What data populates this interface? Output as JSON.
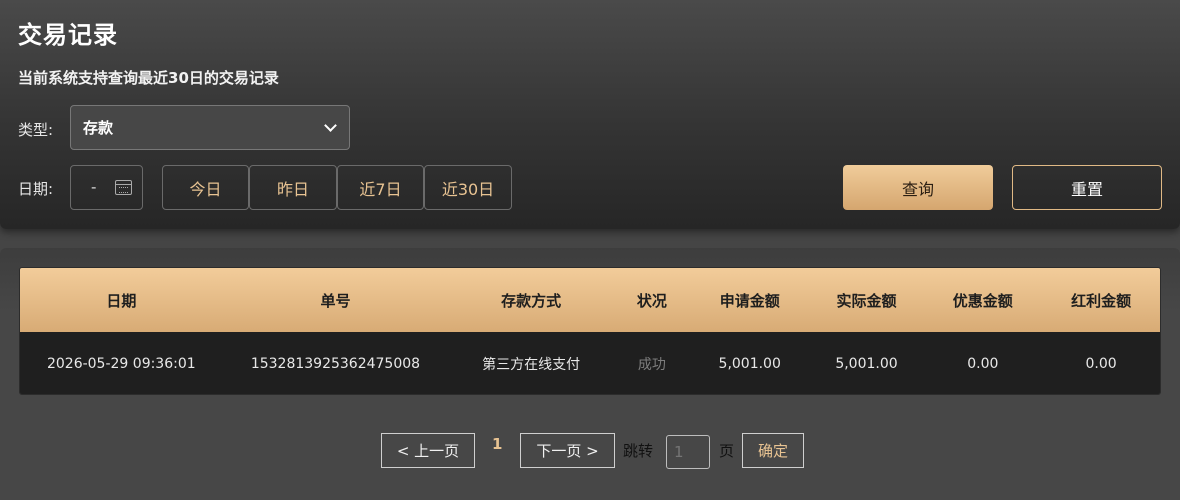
{
  "header": {
    "title": "交易记录",
    "notice": "当前系统支持查询最近30日的交易记录"
  },
  "filters": {
    "type_label": "类型:",
    "type_value": "存款",
    "date_label": "日期:",
    "date_value": "-",
    "quick": [
      "今日",
      "昨日",
      "近7日",
      "近30日"
    ],
    "query_label": "查询",
    "reset_label": "重置"
  },
  "table": {
    "columns": [
      "日期",
      "单号",
      "存款方式",
      "状况",
      "申请金额",
      "实际金额",
      "优惠金额",
      "红利金额"
    ],
    "rows": [
      [
        "2026-05-29 09:36:01",
        "1532813925362475008",
        "第三方在线支付",
        "成功",
        "5,001.00",
        "5,001.00",
        "0.00",
        "0.00"
      ]
    ]
  },
  "pagination": {
    "prev": "< 上一页",
    "current": "1",
    "next": "下一页 >",
    "jump_label": "跳转",
    "jump_value": "1",
    "page_unit": "页",
    "confirm": "确定"
  },
  "colors": {
    "accent_gold": "#e8c392",
    "header_gradient_top": "#f2cc9a",
    "header_gradient_bottom": "#d8ab75",
    "background": "#454545",
    "status_success": "#7d7d7d"
  },
  "icons": {
    "type_select": "chevron-down-icon",
    "date_input": "calendar-icon"
  }
}
